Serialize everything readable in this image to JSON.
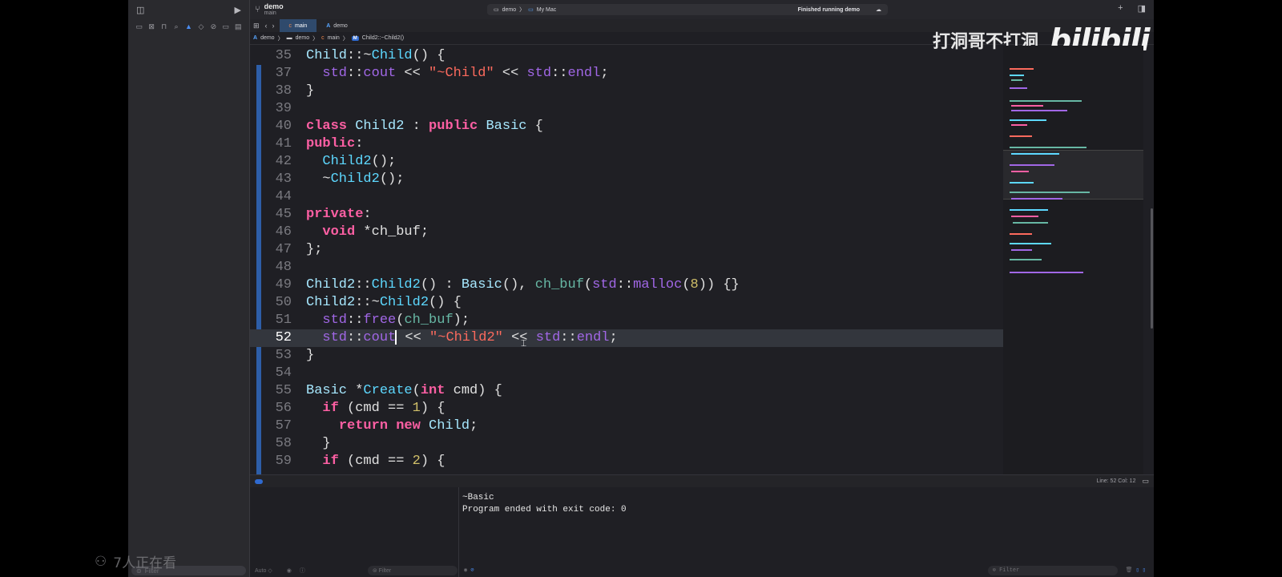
{
  "toolbar": {
    "project_name": "demo",
    "branch": "main",
    "scheme": "demo",
    "separator": "〉",
    "destination": "My Mac",
    "status": "Finished running demo",
    "add_icon": "+"
  },
  "tabs": [
    {
      "label": "main",
      "active": true
    },
    {
      "label": "demo",
      "active": false
    }
  ],
  "jumpbar": {
    "items": [
      "demo",
      "demo",
      "main",
      "Child2::~Child2()"
    ],
    "separator": "〉",
    "method_badge": "M",
    "c_badge": "c"
  },
  "editor": {
    "lines": [
      {
        "num": "35",
        "code": "Child::~Child() {"
      },
      {
        "num": "37",
        "code": "  std::cout << \"~Child\" << std::endl;"
      },
      {
        "num": "38",
        "code": "}"
      },
      {
        "num": "39",
        "code": ""
      },
      {
        "num": "40",
        "code": "class Child2 : public Basic {"
      },
      {
        "num": "41",
        "code": "public:"
      },
      {
        "num": "42",
        "code": "  Child2();"
      },
      {
        "num": "43",
        "code": "  ~Child2();"
      },
      {
        "num": "44",
        "code": ""
      },
      {
        "num": "45",
        "code": "private:"
      },
      {
        "num": "46",
        "code": "  void *ch_buf;"
      },
      {
        "num": "47",
        "code": "};"
      },
      {
        "num": "48",
        "code": ""
      },
      {
        "num": "49",
        "code": "Child2::Child2() : Basic(), ch_buf(std::malloc(8)) {}"
      },
      {
        "num": "50",
        "code": "Child2::~Child2() {"
      },
      {
        "num": "51",
        "code": "  std::free(ch_buf);"
      },
      {
        "num": "52",
        "code": "  std::cout << \"~Child2\" << std::endl;",
        "current": true
      },
      {
        "num": "53",
        "code": "}"
      },
      {
        "num": "54",
        "code": ""
      },
      {
        "num": "55",
        "code": "Basic *Create(int cmd) {"
      },
      {
        "num": "56",
        "code": "  if (cmd == 1) {"
      },
      {
        "num": "57",
        "code": "    return new Child;"
      },
      {
        "num": "58",
        "code": "  }"
      },
      {
        "num": "59",
        "code": "  if (cmd == 2) {"
      }
    ]
  },
  "watermark": {
    "text": "打洞哥不打洞",
    "logo": "bilibili"
  },
  "status_bar": {
    "cursor_position": "Line: 52  Col: 12"
  },
  "console": {
    "lines": [
      "~Basic",
      "Program ended with exit code: 0"
    ]
  },
  "debug": {
    "mode": "Auto ◇",
    "filter_placeholder": "Filter"
  },
  "sidebar": {
    "filter_placeholder": "Filter"
  },
  "overlay": {
    "viewers": "7人正在看"
  },
  "colors": {
    "keyword": "#fc5fa3",
    "type": "#5dd8ff",
    "function": "#67b7a4",
    "library": "#a167e6",
    "string": "#fc6a5d",
    "number": "#d0bf69",
    "accent": "#2f6ad0"
  }
}
